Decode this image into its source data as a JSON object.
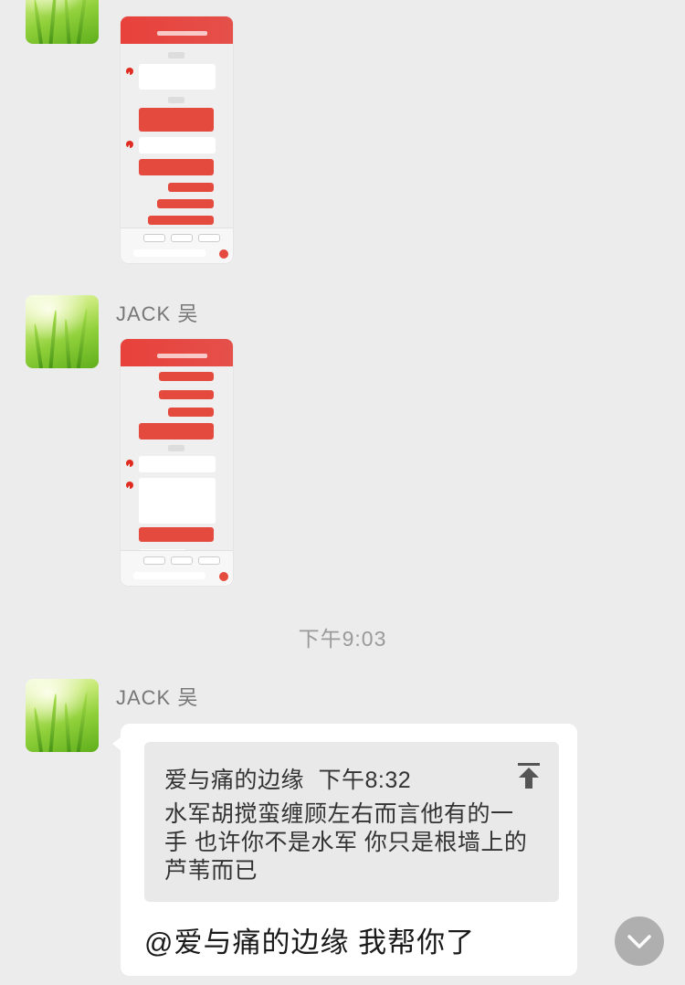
{
  "messages": [
    {
      "type": "image",
      "description": "chat screenshot"
    },
    {
      "sender": "JACK 吴",
      "type": "image"
    },
    {
      "sender": "JACK 吴",
      "type": "reply",
      "quote": {
        "author": "爱与痛的边缘",
        "time": "下午8:32",
        "text": "水军胡搅蛮缠顾左右而言他有的一手 也许你不是水军 你只是根墙上的芦苇而已"
      },
      "text": "@爱与痛的边缘 我帮你了"
    }
  ],
  "timestamp": "下午9:03",
  "icons": {
    "quote_action": "pin-to-top-icon",
    "scroll": "chevron-down-icon"
  },
  "colors": {
    "background": "#ececec",
    "bubble": "#ffffff",
    "quote_bg": "#e9e9e9",
    "accent_red": "#e54a3f"
  }
}
